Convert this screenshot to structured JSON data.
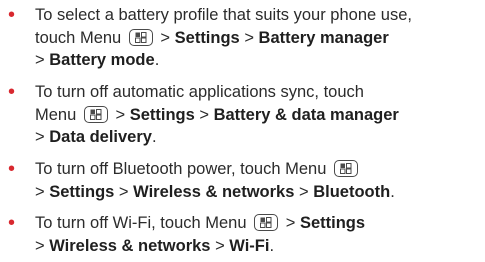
{
  "bullet": "•",
  "icons": {
    "menu_key": "menu-key-icon"
  },
  "colors": {
    "bullet": "#d8282f",
    "text": "#2b2b2b"
  },
  "sep": " > ",
  "tips": [
    {
      "intro": "To select a battery profile that suits your phone use,",
      "touch": "touch Menu",
      "path1": "Settings",
      "path2": "Battery manager",
      "path3": "Battery mode",
      "end": "."
    },
    {
      "intro": "To turn off automatic applications sync, touch",
      "menu": "Menu",
      "path1": "Settings",
      "path2": "Battery & data manager",
      "path3": "Data delivery",
      "end": "."
    },
    {
      "intro": "To turn off Bluetooth power, touch Menu",
      "path1": "Settings",
      "path2": "Wireless & networks",
      "path3": "Bluetooth",
      "end": "."
    },
    {
      "intro": "To turn off Wi-Fi, touch Menu",
      "path1": "Settings",
      "path2": "Wireless & networks",
      "path3": "Wi-Fi",
      "end": "."
    }
  ]
}
